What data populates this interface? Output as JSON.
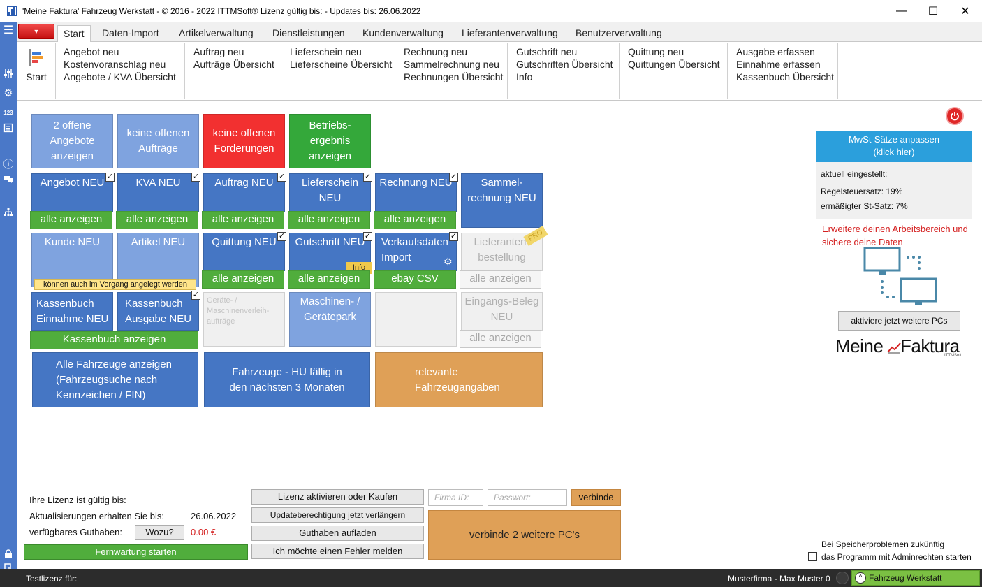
{
  "window": {
    "title": "'Meine Faktura' Fahrzeug Werkstatt - © 2016 - 2022 ITTMSoft® Lizenz gültig bis:  - Updates bis: 26.06.2022",
    "minimize": "—",
    "maximize": "☐",
    "close": "✕"
  },
  "left_strip": [
    "☰",
    "⚙",
    "123",
    "ⓘ"
  ],
  "ribbon": {
    "menu_arrow": "▼",
    "tabs": [
      "Start",
      "Daten-Import",
      "Artikelverwaltung",
      "Dienstleistungen",
      "Kundenverwaltung",
      "Lieferantenverwaltung",
      "Benutzerverwaltung"
    ],
    "start_label": "Start",
    "groups": [
      [
        "Angebot neu",
        "Kostenvoranschlag neu",
        "Angebote / KVA Übersicht"
      ],
      [
        "Auftrag neu",
        "Aufträge Übersicht"
      ],
      [
        "Lieferschein neu",
        "Lieferscheine Übersicht"
      ],
      [
        "Rechnung neu",
        "Sammelrechnung neu",
        "Rechnungen Übersicht"
      ],
      [
        "Gutschrift neu",
        "Gutschriften Übersicht",
        "Info"
      ],
      [
        "Quittung neu",
        "Quittungen Übersicht"
      ],
      [
        "Ausgabe erfassen",
        "Einnahme erfassen",
        "Kassenbuch Übersicht"
      ]
    ]
  },
  "tiles": {
    "offene_angebote": "2 offene Angebote anzeigen",
    "keine_auftraege": "keine offenen Aufträge",
    "keine_forderungen": "keine offenen Forderungen",
    "betriebsergebnis": "Betriebs-ergebnis anzeigen",
    "angebot_neu": "Angebot NEU",
    "kva_neu": "KVA NEU",
    "auftrag_neu": "Auftrag NEU",
    "lieferschein_neu": "Lieferschein NEU",
    "rechnung_neu": "Rechnung NEU",
    "sammelrechnung_neu": "Sammel-rechnung NEU",
    "kunde_neu": "Kunde NEU",
    "artikel_neu": "Artikel NEU",
    "quittung_neu": "Quittung NEU",
    "gutschrift_neu": "Gutschrift NEU",
    "verkaufsdaten_import": "Verkaufsdaten Import",
    "lieferantenbestellung": "Lieferanten-bestellung",
    "kassenbuch_einnahme": "Kassenbuch Einnahme NEU",
    "kassenbuch_ausgabe": "Kassenbuch Ausgabe NEU",
    "geraeteverleih": "Geräte- / Maschinenverleih-aufträge",
    "maschinenpark": "Maschinen- / Gerätepark",
    "eingangsbeleg": "Eingangs-Beleg NEU",
    "alle_fahrzeuge": "Alle Fahrzeuge anzeigen (Fahrzeugsuche nach Kennzeichen / FIN)",
    "hu_faellig": "Fahrzeuge - HU fällig in den nächsten 3 Monaten",
    "fahrzeugangaben": "relevante Fahrzeugangaben"
  },
  "bars": {
    "alle_anzeigen": "alle anzeigen",
    "ebay_csv": "ebay CSV",
    "kassenbuch_anzeigen": "Kassenbuch anzeigen"
  },
  "labels": {
    "info_tag": "Info",
    "pro_tag": "PRO",
    "tooltip": "können auch im Vorgang angelegt werden"
  },
  "right_panel": {
    "mwst_button": "MwSt-Sätze anpassen (klick hier)",
    "aktuell": "aktuell eingestellt:",
    "regelsteuersatz": "Regelsteuersatz: 19%",
    "ermaessigt": "ermäßigter St-Satz: 7%",
    "promo": "Erweitere deinen Arbeitsbereich und sichere deine Daten",
    "aktiviere_pcs": "aktiviere jetzt weitere PCs",
    "logo_left": "Meine",
    "logo_right": "Faktura",
    "logo_sub": "ITTMSoft"
  },
  "license": {
    "gueltig_bis": "Ihre Lizenz ist gültig bis:",
    "aktualisierungen": "Aktualisierungen erhalten Sie bis:",
    "updates_date": "26.06.2022",
    "guthaben_label": "verfügbares Guthaben:",
    "wozu_button": "Wozu?",
    "guthaben_value": "0.00 €",
    "fernwartung": "Fernwartung starten",
    "lizenz_kaufen": "Lizenz aktivieren oder Kaufen",
    "update_verlaengern": "Updateberechtigung jetzt verlängern",
    "guthaben_aufladen": "Guthaben aufladen",
    "fehler_melden": "Ich möchte einen Fehler melden",
    "firma_placeholder": "Firma ID:",
    "passwort_placeholder": "Passwort:",
    "verbinde": "verbinde",
    "verbinde_pcs": "verbinde 2 weitere PC's"
  },
  "admin": {
    "line1": "Bei Speicherproblemen zukünftig",
    "line2": "das Programm mit Adminrechten starten"
  },
  "status": {
    "testlizenz": "Testlizenz für:",
    "user": "Musterfirma - Max Muster 0",
    "module": "Fahrzeug Werkstatt"
  },
  "colors": {
    "tile_light": "#7fa3df",
    "tile_blue": "#4576c4",
    "tile_red": "#f23030",
    "tile_green": "#34a83a",
    "tile_orange": "#dfa057",
    "bar_green": "#50ad3c",
    "mwst_blue": "#2b9fdc",
    "status_green": "#7bc043"
  }
}
